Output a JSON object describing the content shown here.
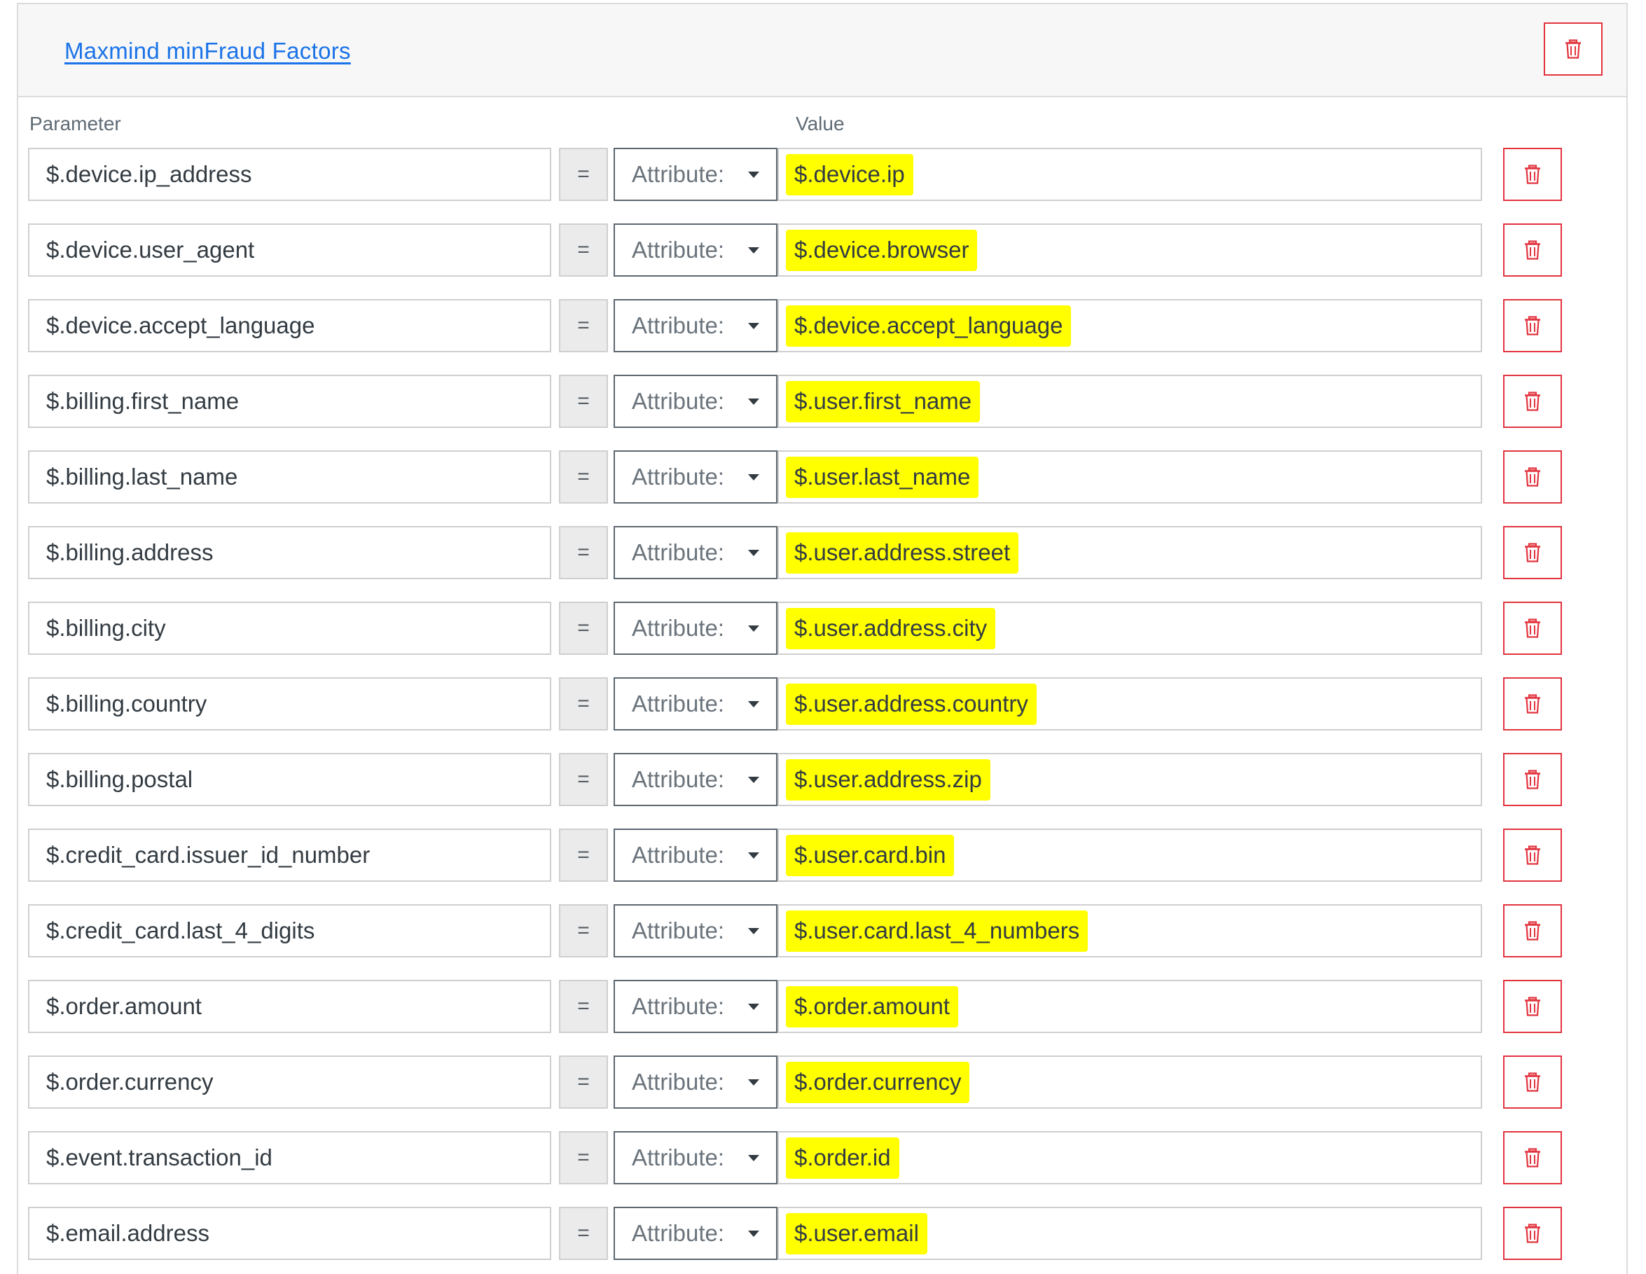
{
  "section": {
    "title": "Maxmind minFraud Factors",
    "delete_icon": "trash-icon"
  },
  "columns": {
    "parameter": "Parameter",
    "value": "Value"
  },
  "colors": {
    "link": "#1a73e8",
    "danger": "#e2343f",
    "highlight": "#ffff00"
  },
  "rows": [
    {
      "parameter": "$.device.ip_address",
      "operator": "=",
      "source": "Attribute:",
      "value": "$.device.ip"
    },
    {
      "parameter": "$.device.user_agent",
      "operator": "=",
      "source": "Attribute:",
      "value": "$.device.browser"
    },
    {
      "parameter": "$.device.accept_language",
      "operator": "=",
      "source": "Attribute:",
      "value": "$.device.accept_language"
    },
    {
      "parameter": "$.billing.first_name",
      "operator": "=",
      "source": "Attribute:",
      "value": "$.user.first_name"
    },
    {
      "parameter": "$.billing.last_name",
      "operator": "=",
      "source": "Attribute:",
      "value": "$.user.last_name"
    },
    {
      "parameter": "$.billing.address",
      "operator": "=",
      "source": "Attribute:",
      "value": "$.user.address.street"
    },
    {
      "parameter": "$.billing.city",
      "operator": "=",
      "source": "Attribute:",
      "value": "$.user.address.city"
    },
    {
      "parameter": "$.billing.country",
      "operator": "=",
      "source": "Attribute:",
      "value": "$.user.address.country"
    },
    {
      "parameter": "$.billing.postal",
      "operator": "=",
      "source": "Attribute:",
      "value": "$.user.address.zip"
    },
    {
      "parameter": "$.credit_card.issuer_id_number",
      "operator": "=",
      "source": "Attribute:",
      "value": "$.user.card.bin"
    },
    {
      "parameter": "$.credit_card.last_4_digits",
      "operator": "=",
      "source": "Attribute:",
      "value": "$.user.card.last_4_numbers"
    },
    {
      "parameter": "$.order.amount",
      "operator": "=",
      "source": "Attribute:",
      "value": "$.order.amount"
    },
    {
      "parameter": "$.order.currency",
      "operator": "=",
      "source": "Attribute:",
      "value": "$.order.currency"
    },
    {
      "parameter": "$.event.transaction_id",
      "operator": "=",
      "source": "Attribute:",
      "value": "$.order.id"
    },
    {
      "parameter": "$.email.address",
      "operator": "=",
      "source": "Attribute:",
      "value": "$.user.email"
    }
  ]
}
